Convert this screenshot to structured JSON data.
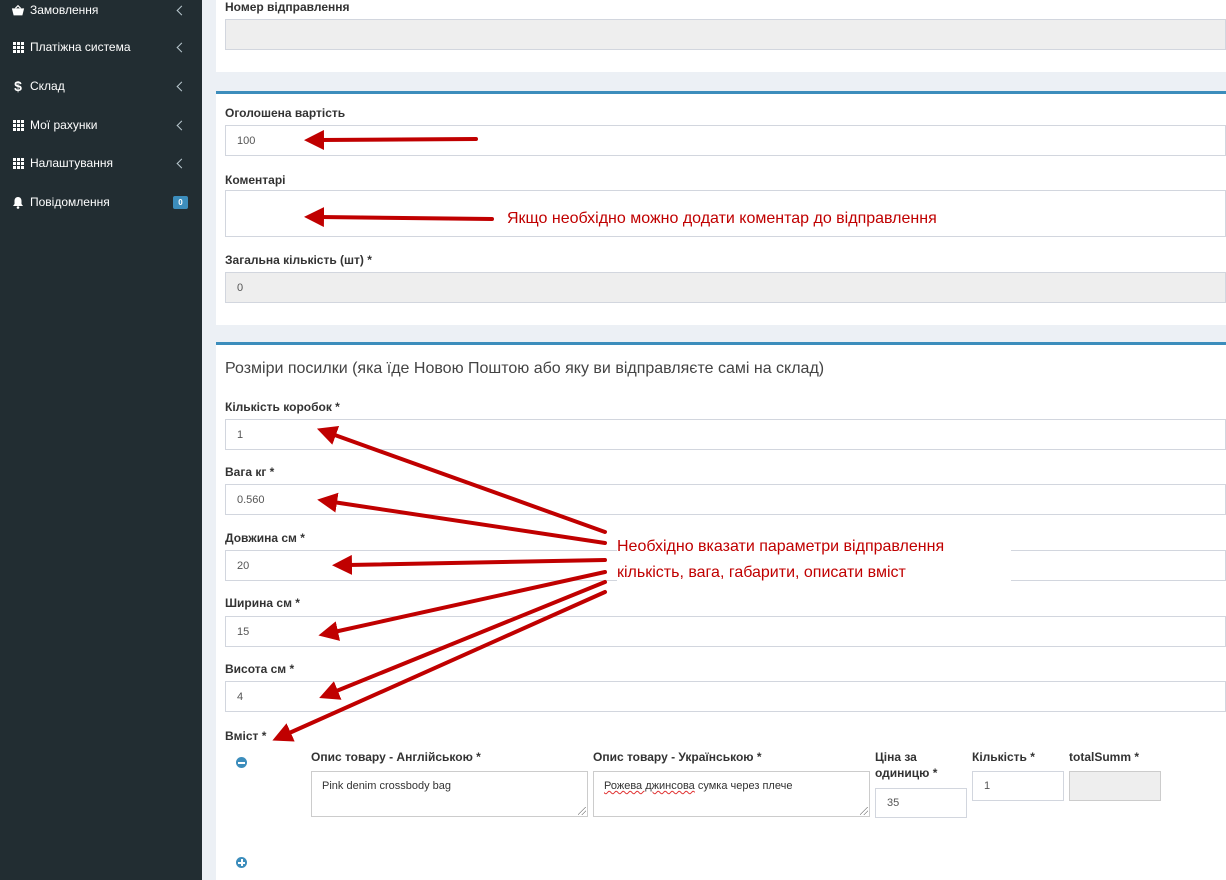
{
  "sidebar": {
    "items": [
      {
        "label": "Замовлення",
        "icon": "basket-icon"
      },
      {
        "label": "Платіжна система",
        "icon": "grid-icon"
      },
      {
        "label": "Склад",
        "icon": "dollar-icon"
      },
      {
        "label": "Мої рахунки",
        "icon": "grid-icon"
      },
      {
        "label": "Налаштування",
        "icon": "grid-icon"
      },
      {
        "label": "Повідомлення",
        "icon": "bell-icon",
        "badge": "0"
      }
    ]
  },
  "box1": {
    "tracking_label": "Номер відправлення",
    "tracking_value": ""
  },
  "box2": {
    "declared_label": "Оголошена вартість",
    "declared_value": "100",
    "comment_label": "Коментарі",
    "comment_value": "",
    "total_label": "Загальна кількість (шт) *",
    "total_value": "0"
  },
  "box3": {
    "title": "Розміри посилки (яка їде Новою Поштою або яку ви відправляєте самі на склад)",
    "boxes_label": "Кількість коробок *",
    "boxes_value": "1",
    "weight_label": "Вага кг *",
    "weight_value": "0.560",
    "length_label": "Довжина см *",
    "length_value": "20",
    "width_label": "Ширина см *",
    "width_value": "15",
    "height_label": "Висота см *",
    "height_value": "4",
    "content_label": "Вміст *",
    "columns": {
      "desc_en": "Опис товару - Англійською *",
      "desc_ua": "Опис товару - Українською *",
      "price": "Ціна за одиницю *",
      "qty": "Кількість *",
      "total": "totalSumm *"
    },
    "row": {
      "desc_en": "Pink denim crossbody bag",
      "desc_ua_misspelled": "Рожева джинсова",
      "desc_ua_rest": " сумка через плече",
      "price": "35",
      "qty": "1",
      "total": ""
    }
  },
  "annotations": {
    "comment_note": "Якщо необхідно можно додати коментар до відправлення",
    "params_line1": "Необхідно вказати параметри відправлення",
    "params_line2": "кількість, вага, габарити, описати вміст",
    "color": "#c00000"
  },
  "colors": {
    "sidebar_bg": "#222d32",
    "accent": "#3c8dbc",
    "annotation": "#c00000"
  }
}
